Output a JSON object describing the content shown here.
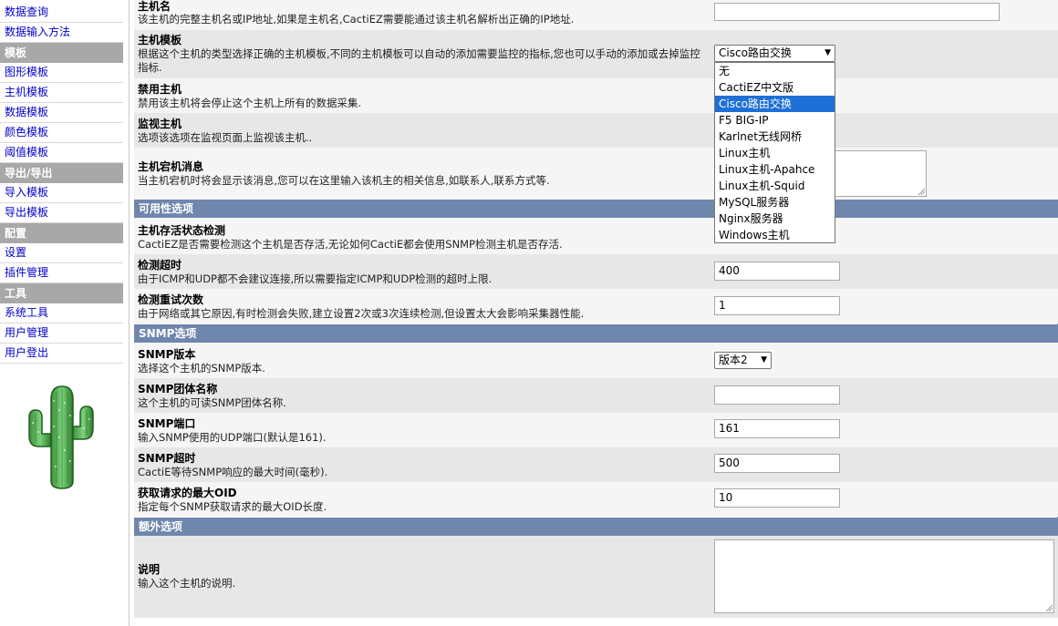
{
  "sidebar": {
    "items": [
      {
        "type": "link",
        "label": "数据查询"
      },
      {
        "type": "link",
        "label": "数据输入方法"
      },
      {
        "type": "header",
        "label": "模板"
      },
      {
        "type": "link",
        "label": "图形模板"
      },
      {
        "type": "link",
        "label": "主机模板"
      },
      {
        "type": "link",
        "label": "数据模板"
      },
      {
        "type": "link",
        "label": "颜色模板"
      },
      {
        "type": "link",
        "label": "阈值模板"
      },
      {
        "type": "header",
        "label": "导出/导出"
      },
      {
        "type": "link",
        "label": "导入模板"
      },
      {
        "type": "link",
        "label": "导出模板"
      },
      {
        "type": "header",
        "label": "配置"
      },
      {
        "type": "link",
        "label": "设置"
      },
      {
        "type": "link",
        "label": "插件管理"
      },
      {
        "type": "header",
        "label": "工具"
      },
      {
        "type": "link",
        "label": "系统工具"
      },
      {
        "type": "link",
        "label": "用户管理"
      },
      {
        "type": "link",
        "label": "用户登出"
      }
    ]
  },
  "form": {
    "hostname": {
      "title": "主机名",
      "desc": "该主机的完整主机名或IP地址,如果是主机名,CactiEZ需要能通过该主机名解析出正确的IP地址.",
      "value": ""
    },
    "host_template": {
      "title": "主机模板",
      "desc": "根据这个主机的类型选择正确的主机模板,不同的主机模板可以自动的添加需要监控的指标,您也可以手动的添加或去掉监控指标.",
      "selected": "Cisco路由交换",
      "options": [
        "无",
        "CactiEZ中文版",
        "Cisco路由交换",
        "F5 BIG-IP",
        "Karlnet无线网桥",
        "Linux主机",
        "Linux主机-Apahce",
        "Linux主机-Squid",
        "MySQL服务器",
        "Nginx服务器",
        "Windows主机"
      ]
    },
    "disable_host": {
      "title": "禁用主机",
      "desc": "禁用该主机将会停止这个主机上所有的数据采集."
    },
    "monitor_host": {
      "title": "监视主机",
      "desc": "选项该选项在监视页面上监视该主机.."
    },
    "down_message": {
      "title": "主机宕机消息",
      "desc": "当主机宕机时将会显示该消息,您可以在这里输入该机主的相关信息,如联系人,联系方式等."
    },
    "availability_section": "可用性选项",
    "status_check": {
      "title": "主机存活状态检测",
      "desc": "CactiEZ是否需要检测这个主机是否存活,无论如何CactiE都会使用SNMP检测主机是否存活."
    },
    "ping_timeout": {
      "title": "检测超时",
      "desc": "由于ICMP和UDP都不会建议连接,所以需要指定ICMP和UDP检测的超时上限.",
      "value": "400"
    },
    "ping_retries": {
      "title": "检测重试次数",
      "desc": "由于网络或其它原因,有时检测会失败,建立设置2次或3次连续检测,但设置太大会影响采集器性能.",
      "value": "1"
    },
    "snmp_section": "SNMP选项",
    "snmp_version": {
      "title": "SNMP版本",
      "desc": "选择这个主机的SNMP版本.",
      "selected": "版本2"
    },
    "snmp_community": {
      "title": "SNMP团体名称",
      "desc": "这个主机的可读SNMP团体名称.",
      "value": ""
    },
    "snmp_port": {
      "title": "SNMP端口",
      "desc": "输入SNMP使用的UDP端口(默认是161).",
      "value": "161"
    },
    "snmp_timeout": {
      "title": "SNMP超时",
      "desc": "CactiE等待SNMP响应的最大时间(毫秒).",
      "value": "500"
    },
    "max_oids": {
      "title": "获取请求的最大OID",
      "desc": "指定每个SNMP获取请求的最大OID长度.",
      "value": "10"
    },
    "extra_section": "额外选项",
    "notes": {
      "title": "说明",
      "desc": "输入这个主机的说明."
    }
  },
  "colors": {
    "section": "#6f86ad",
    "nav_header": "#a8a8a8",
    "highlight": "#1e6fd6",
    "link": "#0000cc"
  }
}
